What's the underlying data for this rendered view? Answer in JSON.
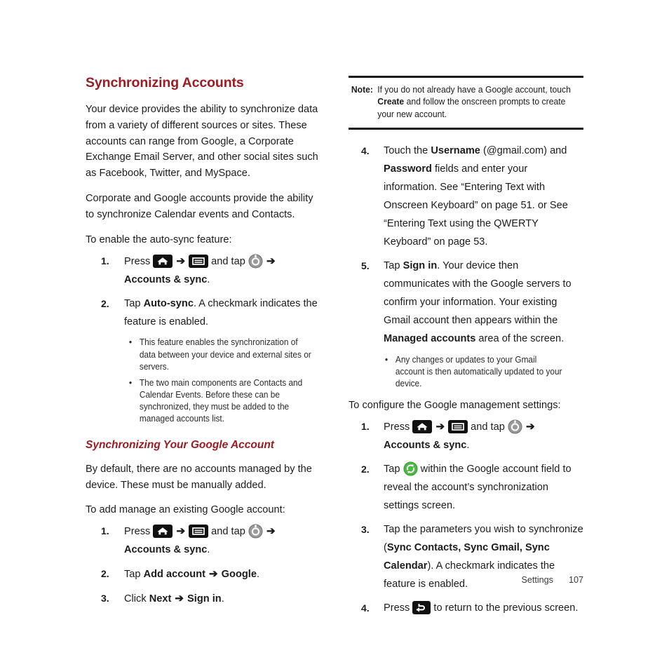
{
  "left_column": {
    "heading": "Synchronizing Accounts",
    "paragraphs": [
      "Your device provides the ability to synchronize data from a variety of different sources or sites. These accounts can range from Google, a Corporate Exchange Email Server, and other social sites such as Facebook, Twitter, and MySpace.",
      "Corporate and Google accounts provide the ability to synchronize Calendar events and Contacts."
    ],
    "lead_1": "To enable the auto-sync feature:",
    "step1": {
      "num": "1.",
      "press_label": "Press",
      "and_tap_label": "and tap",
      "target_bold": "Accounts & sync",
      "period": ".",
      "arrow": "➔",
      "icons": [
        "home-icon",
        "menu-icon",
        "gear-icon"
      ]
    },
    "step2": {
      "num": "2.",
      "tap_label": "Tap ",
      "bold": "Auto-sync",
      "rest": ". A checkmark indicates the feature is enabled."
    },
    "bullets": [
      "This feature enables the synchronization of data between your device and external sites or servers.",
      "The two main components are Contacts and Calendar Events. Before these can be synchronized, they must be added to the managed accounts list."
    ],
    "subheading": "Synchronizing Your Google Account",
    "paragraph_3": "By default, there are no accounts managed by the device. These must be manually added.",
    "lead_2": "To add manage an existing Google account:",
    "step_a1": {
      "num": "1.",
      "press_label": "Press",
      "and_tap_label": "and tap",
      "target_bold": "Accounts & sync",
      "period": "."
    },
    "step_a2": {
      "num": "2.",
      "prefix": "Tap ",
      "bold_1": "Add account",
      "arrow": "➔",
      "bold_2": "Google",
      "suffix": "."
    },
    "step_a3": {
      "num": "3.",
      "prefix": "Click ",
      "bold_1": "Next",
      "arrow": "➔",
      "bold_2": "Sign in",
      "suffix": "."
    }
  },
  "right_column": {
    "note": {
      "label": "Note:",
      "text_before": "If you do not already have a Google account, touch ",
      "bold": "Create",
      "text_after": " and follow the onscreen prompts to create your new account."
    },
    "step4": {
      "num": "4.",
      "t1": "Touch the ",
      "b1": "Username",
      "t2": " (@gmail.com) and ",
      "b2": "Password",
      "t3": " fields and enter your information. See “Entering Text with Onscreen Keyboard” on page 51. or See “Entering Text using the QWERTY Keyboard” on page 53."
    },
    "step5": {
      "num": "5.",
      "t1": "Tap ",
      "b1": "Sign in",
      "t2": ". Your device then communicates with the Google servers to confirm your information. Your existing Gmail account then appears within the ",
      "b2": "Managed accounts",
      "t3": " area of the screen."
    },
    "bullet": "Any changes or updates to your Gmail account is then automatically updated to your device.",
    "lead": "To configure the Google management settings:",
    "step_b1": {
      "num": "1.",
      "press_label": "Press",
      "and_tap_label": "and tap",
      "target_bold": "Accounts & sync",
      "period": "."
    },
    "step_b2": {
      "num": "2.",
      "t1": "Tap ",
      "t2": " within the Google account field to reveal the account’s synchronization settings screen."
    },
    "step_b3": {
      "num": "3.",
      "t1": "Tap the parameters you wish to synchronize (",
      "b1": "Sync Contacts, Sync Gmail, Sync Calendar",
      "t2": "). A checkmark indicates the feature is enabled."
    },
    "step_b4": {
      "num": "4.",
      "t1": "Press ",
      "t2": " to return to the previous screen."
    }
  },
  "footer": {
    "section": "Settings",
    "page_number": "107"
  },
  "colors": {
    "heading_red": "#9e1b22",
    "icon_black": "#111111",
    "sync_green": "#4cb944",
    "gear_gray": "#9a9a9a",
    "body_text": "#1c1c1c"
  },
  "icons": {
    "home": "home-icon",
    "menu": "menu-icon",
    "gear": "gear-icon",
    "sync": "sync-icon",
    "back": "back-icon"
  }
}
